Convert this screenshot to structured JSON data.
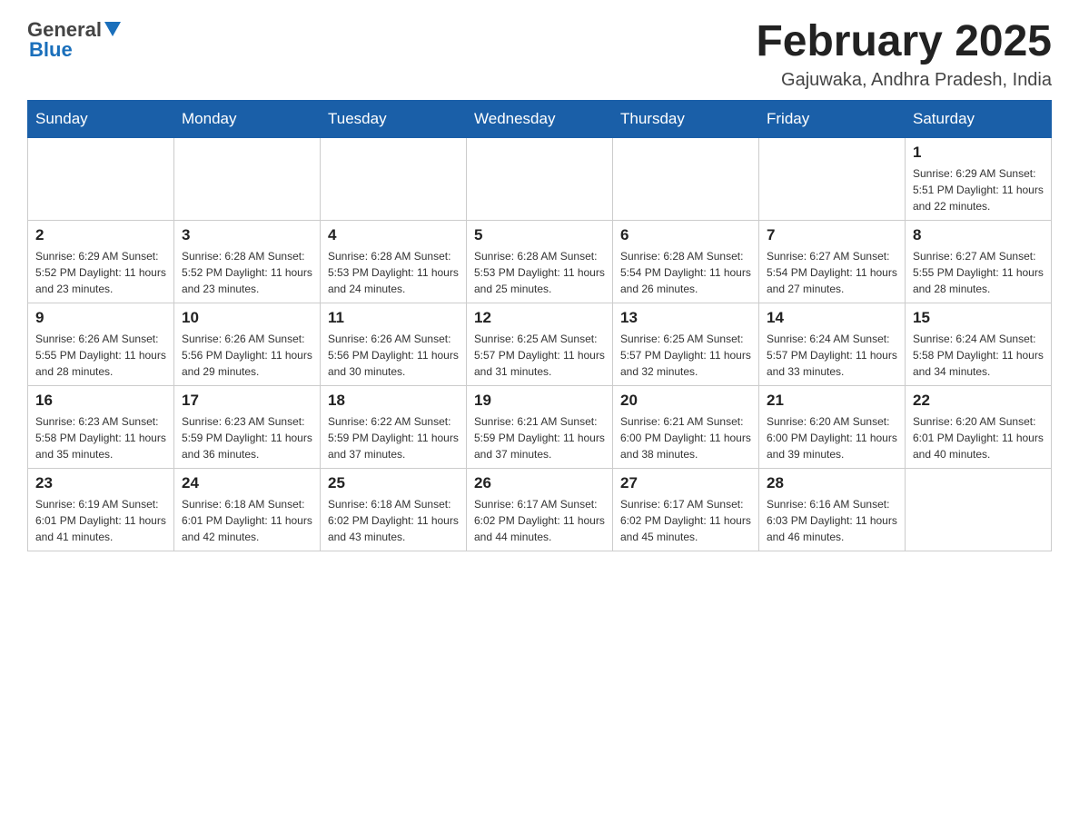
{
  "header": {
    "logo_general": "General",
    "logo_blue": "Blue",
    "month_title": "February 2025",
    "location": "Gajuwaka, Andhra Pradesh, India"
  },
  "days_of_week": [
    "Sunday",
    "Monday",
    "Tuesday",
    "Wednesday",
    "Thursday",
    "Friday",
    "Saturday"
  ],
  "weeks": [
    [
      {
        "day": "",
        "info": ""
      },
      {
        "day": "",
        "info": ""
      },
      {
        "day": "",
        "info": ""
      },
      {
        "day": "",
        "info": ""
      },
      {
        "day": "",
        "info": ""
      },
      {
        "day": "",
        "info": ""
      },
      {
        "day": "1",
        "info": "Sunrise: 6:29 AM\nSunset: 5:51 PM\nDaylight: 11 hours\nand 22 minutes."
      }
    ],
    [
      {
        "day": "2",
        "info": "Sunrise: 6:29 AM\nSunset: 5:52 PM\nDaylight: 11 hours\nand 23 minutes."
      },
      {
        "day": "3",
        "info": "Sunrise: 6:28 AM\nSunset: 5:52 PM\nDaylight: 11 hours\nand 23 minutes."
      },
      {
        "day": "4",
        "info": "Sunrise: 6:28 AM\nSunset: 5:53 PM\nDaylight: 11 hours\nand 24 minutes."
      },
      {
        "day": "5",
        "info": "Sunrise: 6:28 AM\nSunset: 5:53 PM\nDaylight: 11 hours\nand 25 minutes."
      },
      {
        "day": "6",
        "info": "Sunrise: 6:28 AM\nSunset: 5:54 PM\nDaylight: 11 hours\nand 26 minutes."
      },
      {
        "day": "7",
        "info": "Sunrise: 6:27 AM\nSunset: 5:54 PM\nDaylight: 11 hours\nand 27 minutes."
      },
      {
        "day": "8",
        "info": "Sunrise: 6:27 AM\nSunset: 5:55 PM\nDaylight: 11 hours\nand 28 minutes."
      }
    ],
    [
      {
        "day": "9",
        "info": "Sunrise: 6:26 AM\nSunset: 5:55 PM\nDaylight: 11 hours\nand 28 minutes."
      },
      {
        "day": "10",
        "info": "Sunrise: 6:26 AM\nSunset: 5:56 PM\nDaylight: 11 hours\nand 29 minutes."
      },
      {
        "day": "11",
        "info": "Sunrise: 6:26 AM\nSunset: 5:56 PM\nDaylight: 11 hours\nand 30 minutes."
      },
      {
        "day": "12",
        "info": "Sunrise: 6:25 AM\nSunset: 5:57 PM\nDaylight: 11 hours\nand 31 minutes."
      },
      {
        "day": "13",
        "info": "Sunrise: 6:25 AM\nSunset: 5:57 PM\nDaylight: 11 hours\nand 32 minutes."
      },
      {
        "day": "14",
        "info": "Sunrise: 6:24 AM\nSunset: 5:57 PM\nDaylight: 11 hours\nand 33 minutes."
      },
      {
        "day": "15",
        "info": "Sunrise: 6:24 AM\nSunset: 5:58 PM\nDaylight: 11 hours\nand 34 minutes."
      }
    ],
    [
      {
        "day": "16",
        "info": "Sunrise: 6:23 AM\nSunset: 5:58 PM\nDaylight: 11 hours\nand 35 minutes."
      },
      {
        "day": "17",
        "info": "Sunrise: 6:23 AM\nSunset: 5:59 PM\nDaylight: 11 hours\nand 36 minutes."
      },
      {
        "day": "18",
        "info": "Sunrise: 6:22 AM\nSunset: 5:59 PM\nDaylight: 11 hours\nand 37 minutes."
      },
      {
        "day": "19",
        "info": "Sunrise: 6:21 AM\nSunset: 5:59 PM\nDaylight: 11 hours\nand 37 minutes."
      },
      {
        "day": "20",
        "info": "Sunrise: 6:21 AM\nSunset: 6:00 PM\nDaylight: 11 hours\nand 38 minutes."
      },
      {
        "day": "21",
        "info": "Sunrise: 6:20 AM\nSunset: 6:00 PM\nDaylight: 11 hours\nand 39 minutes."
      },
      {
        "day": "22",
        "info": "Sunrise: 6:20 AM\nSunset: 6:01 PM\nDaylight: 11 hours\nand 40 minutes."
      }
    ],
    [
      {
        "day": "23",
        "info": "Sunrise: 6:19 AM\nSunset: 6:01 PM\nDaylight: 11 hours\nand 41 minutes."
      },
      {
        "day": "24",
        "info": "Sunrise: 6:18 AM\nSunset: 6:01 PM\nDaylight: 11 hours\nand 42 minutes."
      },
      {
        "day": "25",
        "info": "Sunrise: 6:18 AM\nSunset: 6:02 PM\nDaylight: 11 hours\nand 43 minutes."
      },
      {
        "day": "26",
        "info": "Sunrise: 6:17 AM\nSunset: 6:02 PM\nDaylight: 11 hours\nand 44 minutes."
      },
      {
        "day": "27",
        "info": "Sunrise: 6:17 AM\nSunset: 6:02 PM\nDaylight: 11 hours\nand 45 minutes."
      },
      {
        "day": "28",
        "info": "Sunrise: 6:16 AM\nSunset: 6:03 PM\nDaylight: 11 hours\nand 46 minutes."
      },
      {
        "day": "",
        "info": ""
      }
    ]
  ]
}
